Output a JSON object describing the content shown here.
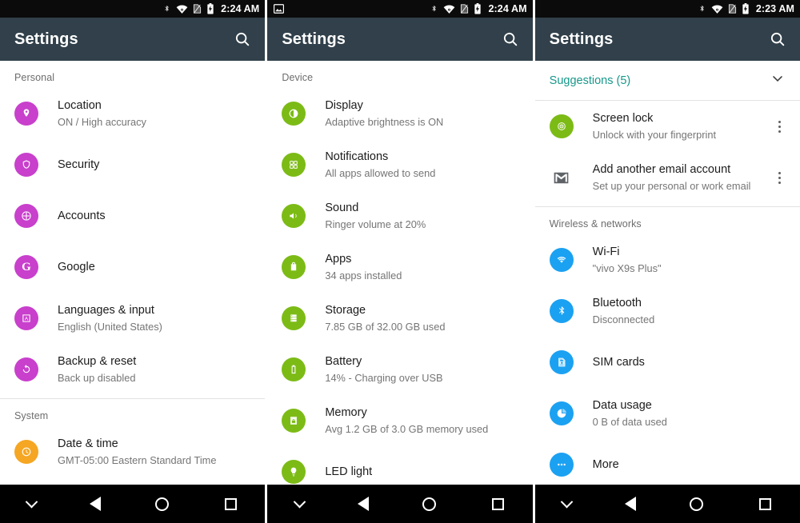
{
  "panels": [
    {
      "statusbar": {
        "time": "2:24 AM",
        "icons": [
          "bluetooth-icon",
          "wifi-icon",
          "no-sim-icon",
          "battery-charging-icon"
        ],
        "has_photo_icon": false
      },
      "appbar": {
        "title": "Settings",
        "search_icon": "search-icon"
      },
      "sections": [
        {
          "header": "Personal",
          "rows": [
            {
              "icon": "location-pin-icon",
              "color": "#c840cc",
              "title": "Location",
              "subtitle": "ON / High accuracy"
            },
            {
              "icon": "shield-icon",
              "color": "#c840cc",
              "title": "Security",
              "subtitle": ""
            },
            {
              "icon": "account-circle-icon",
              "color": "#c840cc",
              "title": "Accounts",
              "subtitle": ""
            },
            {
              "icon": "google-g-icon",
              "color": "#c840cc",
              "title": "Google",
              "subtitle": ""
            },
            {
              "icon": "language-input-icon",
              "color": "#c840cc",
              "title": "Languages & input",
              "subtitle": "English (United States)"
            },
            {
              "icon": "backup-restore-icon",
              "color": "#c840cc",
              "title": "Backup & reset",
              "subtitle": "Back up disabled"
            }
          ]
        },
        {
          "header": "System",
          "rows": [
            {
              "icon": "clock-icon",
              "color": "#f5a623",
              "title": "Date & time",
              "subtitle": "GMT-05:00 Eastern Standard Time"
            }
          ]
        }
      ],
      "navbar": {
        "hide": "chevron-down-icon",
        "back": "back-triangle-icon",
        "home": "home-circle-icon",
        "recents": "recents-square-icon"
      }
    },
    {
      "statusbar": {
        "time": "2:24 AM",
        "icons": [
          "bluetooth-icon",
          "wifi-icon",
          "no-sim-icon",
          "battery-charging-icon"
        ],
        "has_photo_icon": true
      },
      "appbar": {
        "title": "Settings",
        "search_icon": "search-icon"
      },
      "sections": [
        {
          "header": "Device",
          "rows": [
            {
              "icon": "brightness-icon",
              "color": "#7cbb16",
              "title": "Display",
              "subtitle": "Adaptive brightness is ON"
            },
            {
              "icon": "notifications-grid-icon",
              "color": "#7cbb16",
              "title": "Notifications",
              "subtitle": "All apps allowed to send"
            },
            {
              "icon": "volume-icon",
              "color": "#7cbb16",
              "title": "Sound",
              "subtitle": "Ringer volume at 20%"
            },
            {
              "icon": "apps-icon",
              "color": "#7cbb16",
              "title": "Apps",
              "subtitle": "34 apps installed"
            },
            {
              "icon": "storage-icon",
              "color": "#7cbb16",
              "title": "Storage",
              "subtitle": "7.85 GB of 32.00 GB used"
            },
            {
              "icon": "battery-icon",
              "color": "#7cbb16",
              "title": "Battery",
              "subtitle": "14% - Charging over USB"
            },
            {
              "icon": "memory-icon",
              "color": "#7cbb16",
              "title": "Memory",
              "subtitle": "Avg 1.2 GB of 3.0 GB memory used"
            },
            {
              "icon": "led-bulb-icon",
              "color": "#7cbb16",
              "title": "LED light",
              "subtitle": ""
            }
          ]
        }
      ],
      "navbar": {
        "hide": "chevron-down-icon",
        "back": "back-triangle-icon",
        "home": "home-circle-icon",
        "recents": "recents-square-icon"
      }
    },
    {
      "statusbar": {
        "time": "2:23 AM",
        "icons": [
          "bluetooth-icon",
          "wifi-icon",
          "no-sim-icon",
          "battery-charging-icon"
        ],
        "has_photo_icon": false
      },
      "appbar": {
        "title": "Settings",
        "search_icon": "search-icon"
      },
      "suggestions": {
        "label": "Suggestions (5)",
        "expand_icon": "chevron-down-icon",
        "accent": "#18988a"
      },
      "sections": [
        {
          "header": "",
          "rows": [
            {
              "icon": "fingerprint-lock-icon",
              "color": "#7cbb16",
              "title": "Screen lock",
              "subtitle": "Unlock with your fingerprint",
              "kebab": true
            },
            {
              "icon": "gmail-envelope-icon",
              "color": "transparent",
              "title": "Add another email account",
              "subtitle": "Set up your personal or work email",
              "kebab": true
            }
          ]
        },
        {
          "header": "Wireless & networks",
          "rows": [
            {
              "icon": "wifi-icon",
              "color": "#1ba1f2",
              "title": "Wi-Fi",
              "subtitle": "\"vivo X9s Plus\""
            },
            {
              "icon": "bluetooth-icon",
              "color": "#1ba1f2",
              "title": "Bluetooth",
              "subtitle": "Disconnected"
            },
            {
              "icon": "sim-card-icon",
              "color": "#1ba1f2",
              "title": "SIM cards",
              "subtitle": ""
            },
            {
              "icon": "data-usage-pie-icon",
              "color": "#1ba1f2",
              "title": "Data usage",
              "subtitle": "0 B of data used"
            },
            {
              "icon": "more-dots-icon",
              "color": "#1ba1f2",
              "title": "More",
              "subtitle": ""
            }
          ]
        }
      ],
      "navbar": {
        "hide": "chevron-down-icon",
        "back": "back-triangle-icon",
        "home": "home-circle-icon",
        "recents": "recents-square-icon"
      }
    }
  ]
}
